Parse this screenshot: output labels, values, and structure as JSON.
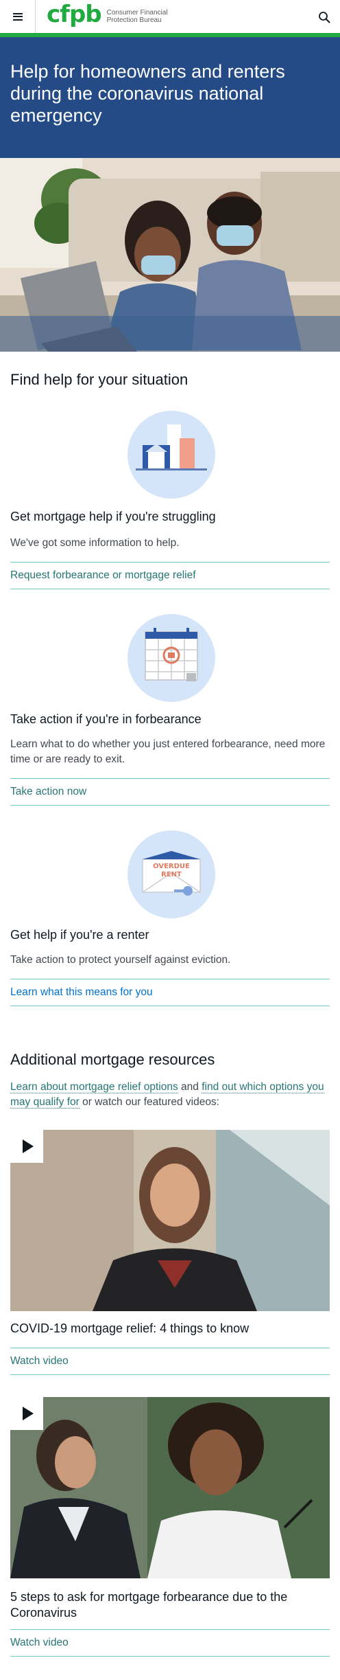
{
  "header": {
    "logo_mark": "cfpb",
    "logo_line1": "Consumer Financial",
    "logo_line2": "Protection Bureau",
    "menu_icon": "hamburger-menu-icon",
    "search_icon": "search-icon"
  },
  "hero": {
    "title": "Help for homeowners and renters during the coronavirus national emergency"
  },
  "situation": {
    "heading": "Find help for your situation",
    "cards": [
      {
        "title": "Get mortgage help if you're struggling",
        "description": "We've got some information to help.",
        "link": "Request forbearance or mortgage relief"
      },
      {
        "title": "Take action if you're in forbearance",
        "description": "Learn what to do whether you just entered forbearance, need more time or are ready to exit.",
        "link": "Take action now"
      },
      {
        "title": "Get help if you're a renter",
        "description": "Take action to protect yourself against eviction.",
        "link": "Learn what this means for you",
        "illustration_text_1": "OVERDUE",
        "illustration_text_2": "RENT"
      }
    ]
  },
  "resources": {
    "heading": "Additional mortgage resources",
    "link1": "Learn about mortgage relief options",
    "and": " and ",
    "link2": "find out which options you may qualify for",
    "suffix": " or watch our featured videos:",
    "videos": [
      {
        "title": "COVID-19 mortgage relief: 4 things to know",
        "link": "Watch video"
      },
      {
        "title": "5 steps to ask for mortgage forbearance due to the Coronavirus",
        "link": "Watch video"
      }
    ]
  },
  "colors": {
    "brand_green": "#20aa3f",
    "hero_blue": "#254b87",
    "link_teal": "#257675",
    "link_blue": "#0072ce",
    "divider": "#75c2c8"
  }
}
